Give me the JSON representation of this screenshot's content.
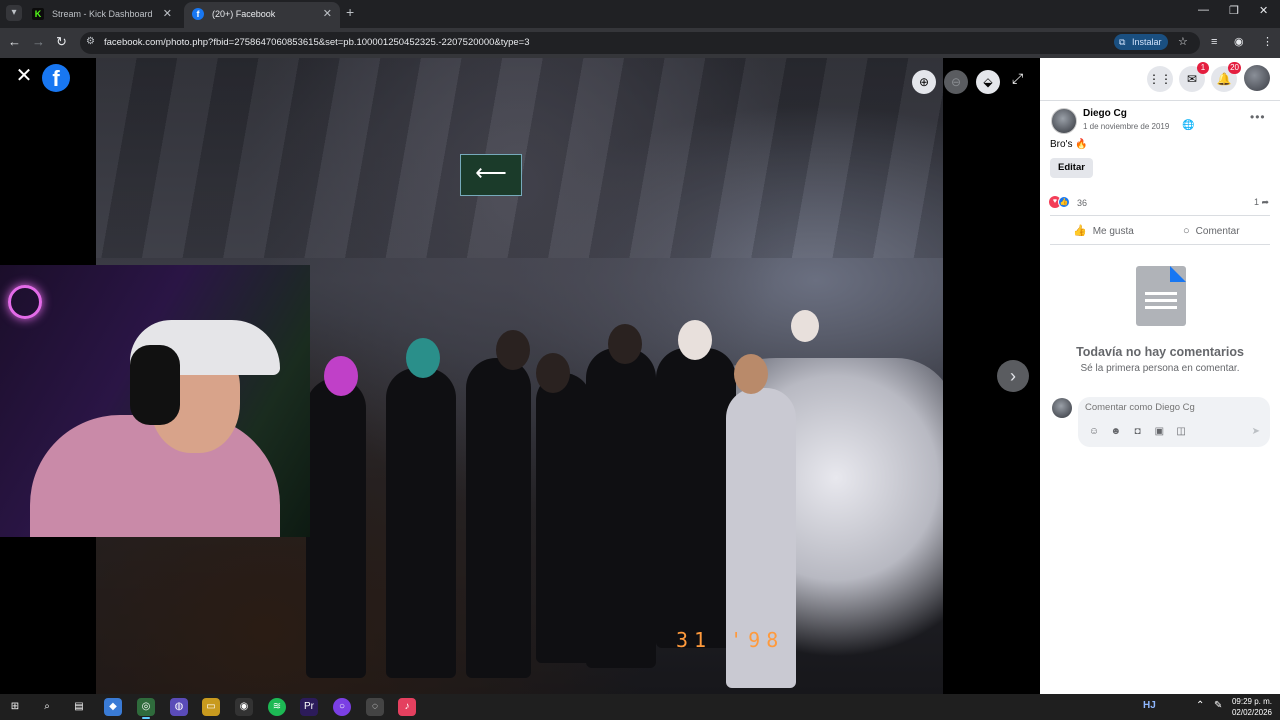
{
  "browser": {
    "tabs": [
      {
        "title": "Stream - Kick Dashboard",
        "favicon": "kick-icon"
      },
      {
        "title": "(20+) Facebook",
        "favicon": "facebook-icon"
      }
    ],
    "url": "facebook.com/photo.php?fbid=2758647060853615&set=pb.100001250452325.-2207520000&type=3",
    "install_label": "Instalar"
  },
  "photo": {
    "date_stamp": "31 '98"
  },
  "post": {
    "author": "Diego Cg",
    "date": "1 de noviembre de 2019",
    "caption": "Bro's 🔥",
    "edit_label": "Editar",
    "reaction_count": "36",
    "share_count": "1",
    "like_label": "Me gusta",
    "comment_label": "Comentar"
  },
  "header": {
    "messenger_badge": "1",
    "notifications_badge": "20"
  },
  "comments": {
    "empty_title": "Todavía no hay comentarios",
    "empty_subtitle": "Sé la primera persona en comentar.",
    "input_placeholder": "Comentar como Diego Cg"
  },
  "taskbar": {
    "time": "09:29 p. m.",
    "date": "02/02/2026"
  },
  "colors": {
    "facebook_blue": "#1877f2",
    "badge_red": "#e41e3f",
    "kick_green": "#53fc18"
  }
}
